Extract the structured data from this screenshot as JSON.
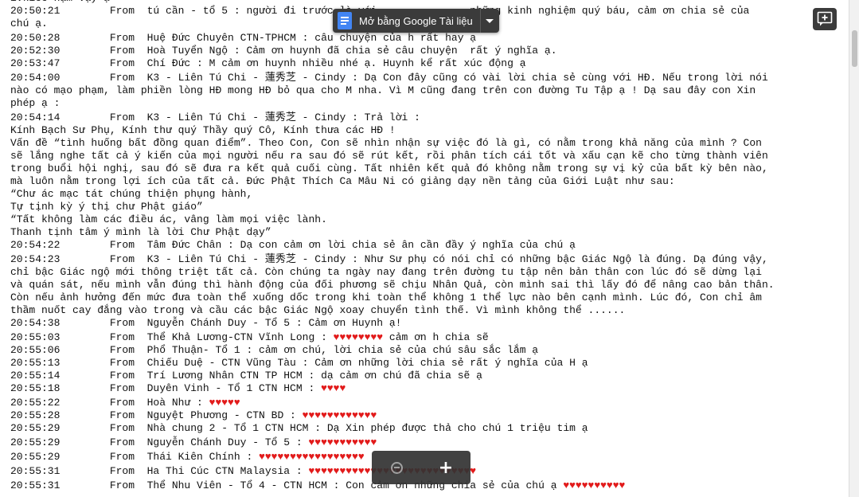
{
  "toolbar": {
    "open_with_label": "Mở bằng Google Tài liệu",
    "docs_icon": "google-docs-icon",
    "dropdown_icon": "caret-down-icon",
    "add_comment_icon": "add-comment-icon"
  },
  "zoom": {
    "zoom_out_icon": "zoom-out-icon",
    "zoom_in_icon": "zoom-in-icon",
    "zoom_in_label": "+"
  },
  "colors": {
    "heart": "#e21b1b",
    "viewer_bg": "#525659",
    "toolbar_bg": "#3b3b3b"
  },
  "document": {
    "lines": [
      {
        "text": "ivkiếc nạm vậy ạ",
        "gap": false
      },
      {
        "text": "20:50:21        From  tú cần - tổ 5 : người đi trước là với...            những kinh nghiệm quý báu, cảm ơn chia sẻ của",
        "gap": false
      },
      {
        "text": "chú ạ.",
        "gap": false
      },
      {
        "text": "20:50:28        From  Huệ Đức Chuyên CTN-TPHCM : câu chuyện của h rất hay ạ",
        "gap": true
      },
      {
        "text": "20:52:30        From  Hoà Tuyển Ngộ : Cảm ơn huynh đã chia sẻ câu chuyện  rất ý nghĩa ạ.",
        "gap": false
      },
      {
        "text": "20:53:47        From  Chí Đức : M cảm ơn huynh nhiều nhé ạ. Huynh kể rất xúc động ạ",
        "gap": false
      },
      {
        "text": "20:54:00        From  K3 - Liên Tú Chi - 蓮秀芝 - Cindy : Dạ Con đây cũng có vài lời chia sẻ cùng với HĐ. Nếu trong lời nói",
        "gap": true
      },
      {
        "text": "nào có mạo phạm, làm phiền lòng HĐ mong HĐ bỏ qua cho M nha. Vì M cũng đang trên con đường Tu Tập ạ ! Dạ sau đây con Xin",
        "gap": false
      },
      {
        "text": "phép ạ :",
        "gap": false
      },
      {
        "text": "20:54:14        From  K3 - Liên Tú Chi - 蓮秀芝 - Cindy : Trả lời :",
        "gap": true
      },
      {
        "text": "Kính Bạch Sư Phụ, Kính thư quý Thầy quý Cô, Kính thưa các HĐ !",
        "gap": false
      },
      {
        "text": "Vấn đề “tình huống bất đồng quan điểm”. Theo Con, Con sẽ nhìn nhận sự việc đó là gì, có nằm trong khả năng của mình ? Con",
        "gap": false
      },
      {
        "text": "sẽ lắng nghe tất cả ý kiến của mọi người nếu ra sau đó sẽ rút kết, rồi phân tích cái tốt và xấu cạn kẽ cho từng thành viên",
        "gap": false
      },
      {
        "text": "trong buổi hội nghị, sau đó sẽ đưa ra kết quả cuối cùng. Tất nhiên kết quả đó không nằm trong sự vị kỷ của bất kỳ bên nào,",
        "gap": false
      },
      {
        "text": "mà luôn nằm trong lợi ích của tất cả. Đức Phật Thích Ca Mâu Ni có giảng dạy nền tảng của Giới Luật như sau:",
        "gap": false
      },
      {
        "text": "“Chư ác mạc tát chúng thiện phụng hành,",
        "gap": false
      },
      {
        "text": "Tự tịnh kỳ ý thị chư Phật giáo”",
        "gap": false
      },
      {
        "text": "“Tất không làm các điều ác, vâng làm mọi việc lành.",
        "gap": false
      },
      {
        "text": "Thanh tịnh tâm ý mình là lời Chư Phật dạy”",
        "gap": false
      },
      {
        "text": "20:54:22        From  Tâm Đức Chân : Dạ con cảm ơn lời chia sẻ ân cần đầy ý nghĩa của chú ạ",
        "gap": false
      },
      {
        "text": "20:54:23        From  K3 - Liên Tú Chi - 蓮秀芝 - Cindy : Như Sư phụ có nói chỉ có những bậc Giác Ngộ là đúng. Dạ đúng vậy,",
        "gap": true
      },
      {
        "text": "chỉ bậc Giác ngộ mới thông triệt tất cả. Còn chúng ta ngày nay đang trên đường tu tập nên bản thân con lúc đó sẽ dừng lại",
        "gap": false
      },
      {
        "text": "và quán sát, nếu mình vẫn đúng thì hành động của đối phương sẽ chịu Nhân Quả, còn mình sai thì lấy đó để nâng cao bản thân.",
        "gap": false
      },
      {
        "text": "Còn nếu ảnh hưởng đến mức đưa toàn thể xuống dốc trong khi toàn thể không 1 thể lực nào bên cạnh mình. Lúc đó, Con chỉ âm",
        "gap": false
      },
      {
        "text": "thầm nuốt cay đắng vào trong và cầu các bậc Giác Ngộ xoay chuyển tình thế. Vì mình không thể ......",
        "gap": false
      },
      {
        "text": "20:54:38        From  Nguyễn Chánh Duy - Tổ 5 : Cảm ơn Huynh ạ!",
        "gap": false
      },
      {
        "text": "20:55:03        From  Thể Khả Lương-CTN Vĩnh Long : ♥♥♥♥♥♥♥♥ cảm ơn h chia sẽ",
        "gap": true
      },
      {
        "text": "20:55:06        From  Phổ Thuận- Tổ 1 : cảm ơn chú, lời chia sẻ của chú sâu sắc lắm ạ",
        "gap": false
      },
      {
        "text": "20:55:13        From  Chiếu Duệ - CTN Vũng Tàu : Cảm ơn những lời chia sẻ rất ý nghĩa của H ạ",
        "gap": false
      },
      {
        "text": "20:55:14        From  Trí Lương Nhân CTN TP HCM : dạ cảm ơn chú đã chia sẽ ạ",
        "gap": false
      },
      {
        "text": "20:55:18        From  Duyên Vinh - Tổ 1 CTN HCM : ♥♥♥♥",
        "gap": false
      },
      {
        "text": "20:55:22        From  Hoà Như : ♥♥♥♥♥",
        "gap": true
      },
      {
        "text": "20:55:28        From  Nguyệt Phương - CTN BD : ♥♥♥♥♥♥♥♥♥♥♥♥",
        "gap": false
      },
      {
        "text": "20:55:29        From  Nhà chung 2 - Tổ 1 CTN HCM : Dạ Xin phép được thả cho chú 1 triệu tim ạ",
        "gap": false
      },
      {
        "text": "20:55:29        From  Nguyễn Chánh Duy - Tổ 5 : ♥♥♥♥♥♥♥♥♥♥♥",
        "gap": true
      },
      {
        "text": "20:55:29        From  Thái Kiên Chính : ♥♥♥♥♥♥♥♥♥♥♥♥♥♥♥♥♥",
        "gap": true
      },
      {
        "text": "20:55:31        From  Ha Thi Cúc CTN Malaysia : ♥♥♥♥♥♥♥♥♥♥♥♥♥♥♥♥♥♥♥♥♥♥♥♥♥♥♥",
        "gap": true
      },
      {
        "text": "20:55:31        From  Thể Nhu Viên - Tổ 4 - CTN HCM : Con cảm ơn những chia sẻ của chú ạ ♥♥♥♥♥♥♥♥♥♥",
        "gap": true
      }
    ]
  }
}
